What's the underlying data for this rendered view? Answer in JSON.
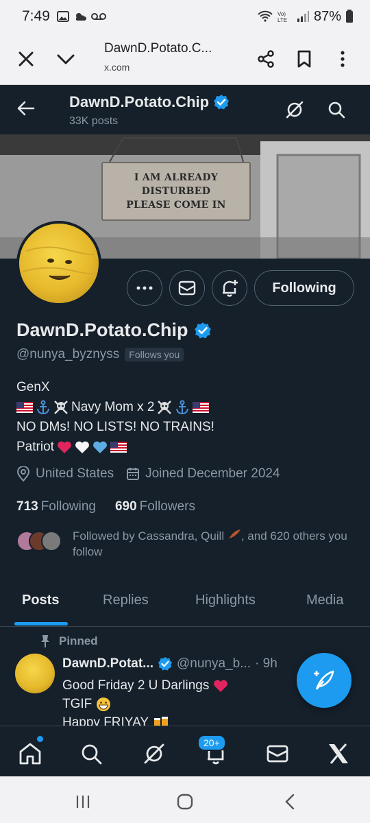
{
  "status_bar": {
    "time": "7:49",
    "battery": "87%"
  },
  "browser": {
    "title": "DawnD.Potato.C...",
    "host": "x.com"
  },
  "header": {
    "display_name": "DawnD.Potato.Chip",
    "posts_count": "33K posts"
  },
  "banner": {
    "sign_lines": [
      "I AM ALREADY",
      "DISTURBED",
      "PLEASE COME IN"
    ]
  },
  "profile": {
    "display_name": "DawnD.Potato.Chip",
    "handle": "@nunya_byznyss",
    "follows_you": "Follows you",
    "bio_lines": {
      "line1": "GenX",
      "line2": "Navy Mom x 2",
      "line3": "NO DMs! NO LISTS! NO TRAINS!",
      "line4": "Patriot"
    },
    "location": "United States",
    "joined": "Joined December 2024",
    "following_count": "713",
    "following_label": "Following",
    "followers_count": "690",
    "followers_label": "Followers",
    "followed_by_prefix": "Followed by Cassandra, Quill",
    "followed_by_suffix": ", and 620 others you follow"
  },
  "actions": {
    "following_label": "Following"
  },
  "tabs": {
    "posts": "Posts",
    "replies": "Replies",
    "highlights": "Highlights",
    "media": "Media"
  },
  "post": {
    "pinned_label": "Pinned",
    "name": "DawnD.Potat...",
    "handle": "@nunya_b...",
    "time": "· 9h",
    "line1": "Good Friday 2 U Darlings",
    "line2": "TGIF",
    "line3": "Happy FRIYAY"
  },
  "bottom_nav": {
    "notifications_badge": "20+"
  },
  "colors": {
    "accent": "#1d9bf0",
    "background": "#15202b",
    "muted": "#8b98a5",
    "heart_red": "#e0245e"
  }
}
